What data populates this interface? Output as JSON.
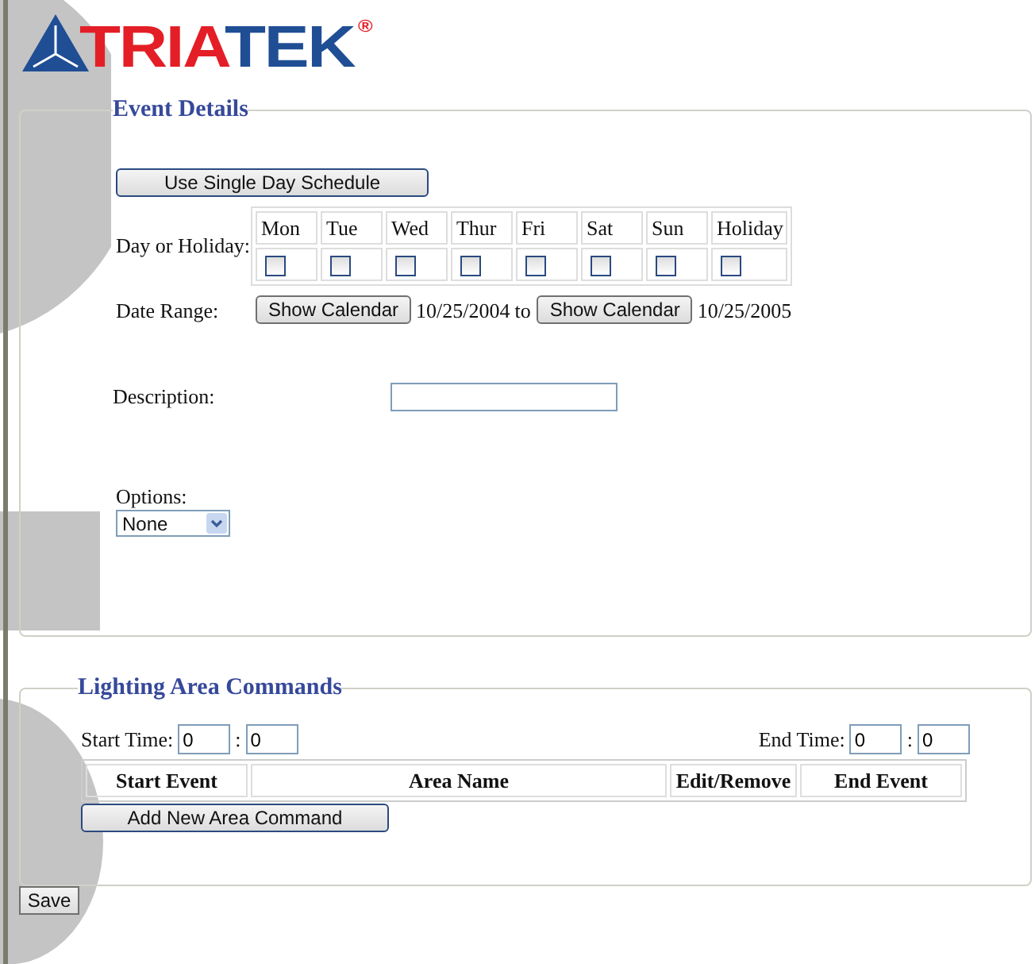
{
  "logo": {
    "parts": [
      "TRIA",
      "TEK"
    ],
    "registered": "®"
  },
  "event_details": {
    "legend": "Event Details",
    "single_day_button": "Use Single Day Schedule",
    "day_label": "Day or Holiday:",
    "days": [
      {
        "label": "Mon",
        "checked": false
      },
      {
        "label": "Tue",
        "checked": false
      },
      {
        "label": "Wed",
        "checked": false
      },
      {
        "label": "Thur",
        "checked": false
      },
      {
        "label": "Fri",
        "checked": false
      },
      {
        "label": "Sat",
        "checked": false
      },
      {
        "label": "Sun",
        "checked": false
      },
      {
        "label": "Holiday",
        "checked": false
      }
    ],
    "date_range_label": "Date Range:",
    "start_calendar_button": "Show Calendar",
    "start_date": "10/25/2004",
    "to": "to",
    "end_calendar_button": "Show Calendar",
    "end_date": "10/25/2005",
    "description_label": "Description:",
    "options_label": "Options:",
    "options_value": "None"
  },
  "lighting": {
    "legend": "Lighting Area Commands",
    "start_time_label": "Start Time:",
    "start_hour": "0",
    "start_minute": "0",
    "end_time_label": "End Time:",
    "end_hour": "0",
    "end_minute": "0",
    "colon": ":",
    "columns": [
      "Start Event",
      "Area Name",
      "Edit/Remove",
      "End Event"
    ],
    "add_button": "Add New Area Command"
  },
  "save_button": "Save"
}
